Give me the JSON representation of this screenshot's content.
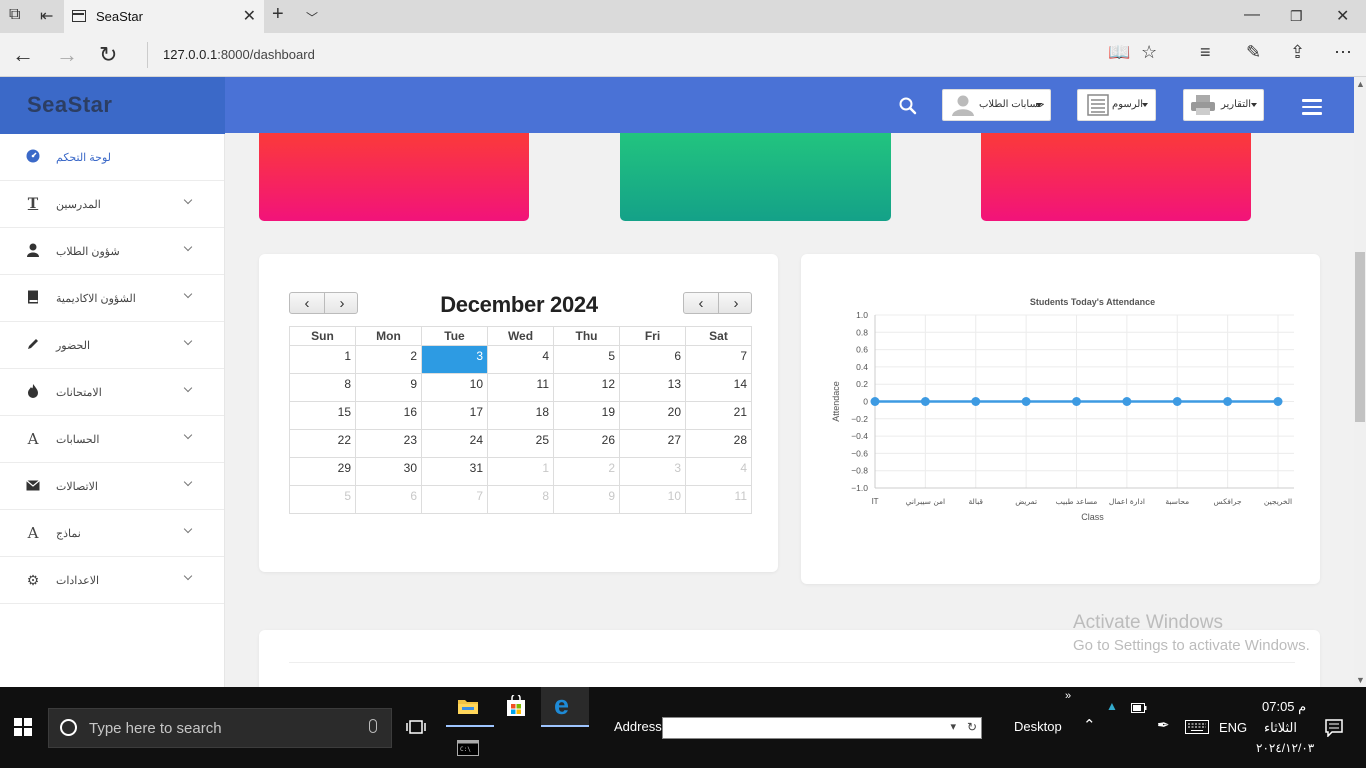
{
  "browser": {
    "tab_title": "SeaStar",
    "url_host": "127.0.0.1",
    "url_path": ":8000/dashboard"
  },
  "app": {
    "brand": "SeaStar",
    "accent": "#3b69c8",
    "navbar_color": "#4a72d6",
    "top_menu": [
      {
        "label": "التقارير",
        "icon": "printer-icon"
      },
      {
        "label": "الرسوم",
        "icon": "list-icon"
      },
      {
        "label": "حسابات الطلاب",
        "icon": "user-icon"
      }
    ],
    "sidebar": [
      {
        "label": "لوحة التحكم",
        "icon": "dashboard-icon",
        "active": true
      },
      {
        "label": "المدرسين",
        "icon": "text-icon"
      },
      {
        "label": "شؤون الطلاب",
        "icon": "user-icon"
      },
      {
        "label": "الشؤون الاكاديمية",
        "icon": "book-icon"
      },
      {
        "label": "الحضور",
        "icon": "pencil-icon"
      },
      {
        "label": "الامتحانات",
        "icon": "fire-icon"
      },
      {
        "label": "الحسابات",
        "icon": "font-icon"
      },
      {
        "label": "الاتصالات",
        "icon": "envelope-icon"
      },
      {
        "label": "نماذج",
        "icon": "font-icon"
      },
      {
        "label": "الاعدادات",
        "icon": "gear-icon"
      }
    ],
    "stat_cards": [
      {
        "color_top": "#fb3a3a",
        "color_bottom": "#f2137a"
      },
      {
        "color_top": "#22c47f",
        "color_bottom": "#14a188"
      },
      {
        "color_top": "#fb3a3a",
        "color_bottom": "#f2137a"
      }
    ]
  },
  "calendar": {
    "title": "December 2024",
    "weekdays": [
      "Sun",
      "Mon",
      "Tue",
      "Wed",
      "Thu",
      "Fri",
      "Sat"
    ],
    "weeks": [
      [
        "1",
        "2",
        "3",
        "4",
        "5",
        "6",
        "7"
      ],
      [
        "8",
        "9",
        "10",
        "11",
        "12",
        "13",
        "14"
      ],
      [
        "15",
        "16",
        "17",
        "18",
        "19",
        "20",
        "21"
      ],
      [
        "22",
        "23",
        "24",
        "25",
        "26",
        "27",
        "28"
      ],
      [
        "29",
        "30",
        "31",
        "1",
        "2",
        "3",
        "4"
      ],
      [
        "5",
        "6",
        "7",
        "8",
        "9",
        "10",
        "11"
      ]
    ],
    "today": "3"
  },
  "chart_data": {
    "type": "line",
    "title": "Students Today's Attendance",
    "xlabel": "Class",
    "ylabel": "Attendace",
    "categories": [
      "IT",
      "امن سيبراني",
      "قبالة",
      "تمريض",
      "مساعد طبيب",
      "ادارة اعمال",
      "محاسبة",
      "جرافكس",
      "الخريجين"
    ],
    "series": [
      {
        "values": [
          0,
          0,
          0,
          0,
          0,
          0,
          0,
          0,
          0
        ],
        "color": "#3d9ae2"
      }
    ],
    "ylim": [
      -1.0,
      1.0
    ],
    "yticks": [
      "1.0",
      "0.8",
      "0.6",
      "0.4",
      "0.2",
      "0",
      "−0.2",
      "−0.4",
      "−0.6",
      "−0.8",
      "−1.0"
    ],
    "grid": true
  },
  "watermark": {
    "line1": "Activate Windows",
    "line2": "Go to Settings to activate Windows."
  },
  "taskbar": {
    "search_placeholder": "Type here to search",
    "address_label": "Address",
    "desktop_label": "Desktop",
    "language": "ENG",
    "time": "07:05 م",
    "day": "الثلاثاء",
    "date": "٢٠٢٤/١٢/٠٣"
  }
}
